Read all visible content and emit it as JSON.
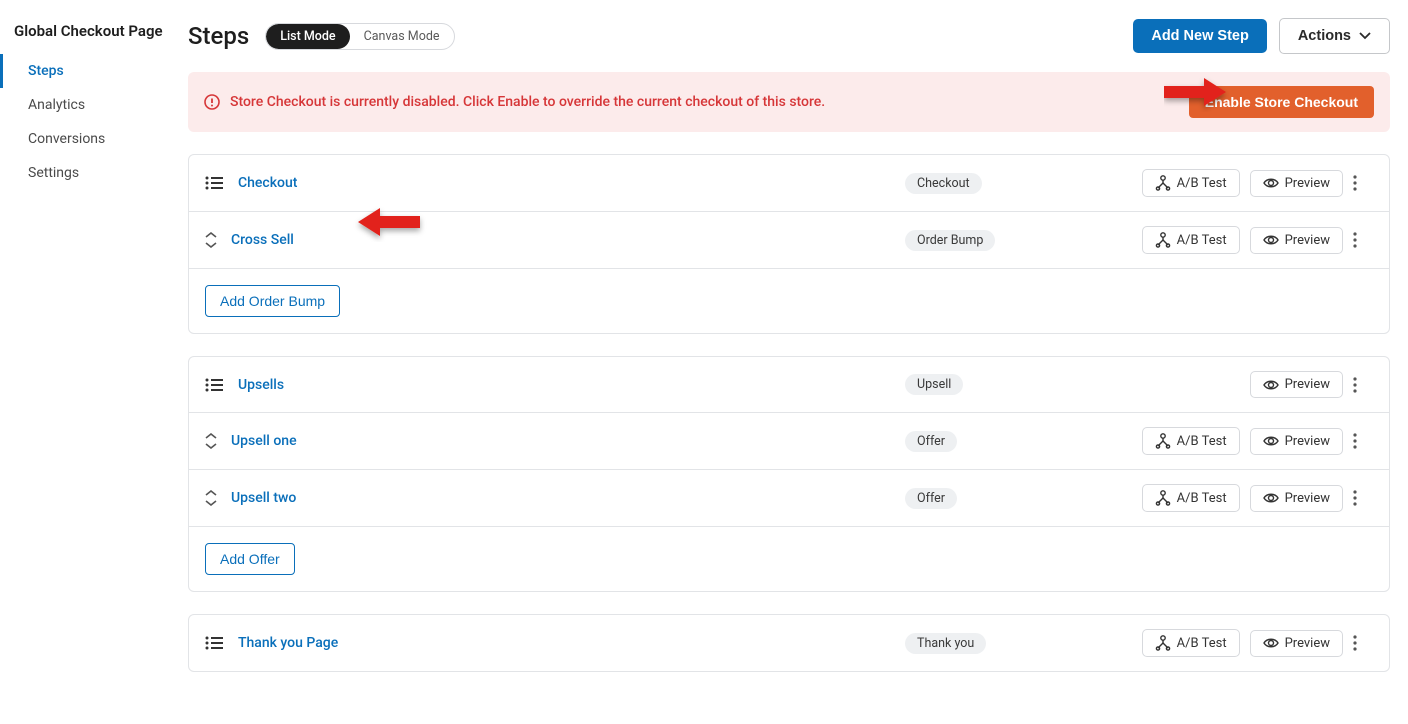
{
  "sidebar": {
    "title": "Global Checkout Page",
    "items": [
      {
        "label": "Steps",
        "active": true
      },
      {
        "label": "Analytics",
        "active": false
      },
      {
        "label": "Conversions",
        "active": false
      },
      {
        "label": "Settings",
        "active": false
      }
    ]
  },
  "page": {
    "title": "Steps",
    "mode_list": "List Mode",
    "mode_canvas": "Canvas Mode"
  },
  "header_actions": {
    "add_step": "Add New Step",
    "actions": "Actions"
  },
  "alert": {
    "text": "Store Checkout is currently disabled. Click Enable to override the current checkout of this store.",
    "enable_btn": "Enable Store Checkout"
  },
  "buttons": {
    "ab_test": "A/B Test",
    "preview": "Preview"
  },
  "groups": [
    {
      "head": {
        "label": "Checkout",
        "tag": "Checkout",
        "show_ab": true
      },
      "rows": [
        {
          "label": "Cross Sell",
          "tag": "Order Bump",
          "show_ab": true,
          "arrow": true
        }
      ],
      "add_label": "Add Order Bump"
    },
    {
      "head": {
        "label": "Upsells",
        "tag": "Upsell",
        "show_ab": false
      },
      "rows": [
        {
          "label": "Upsell one",
          "tag": "Offer",
          "show_ab": true
        },
        {
          "label": "Upsell two",
          "tag": "Offer",
          "show_ab": true
        }
      ],
      "add_label": "Add Offer"
    },
    {
      "head": {
        "label": "Thank you Page",
        "tag": "Thank you",
        "show_ab": true
      },
      "rows": [],
      "add_label": null
    }
  ]
}
